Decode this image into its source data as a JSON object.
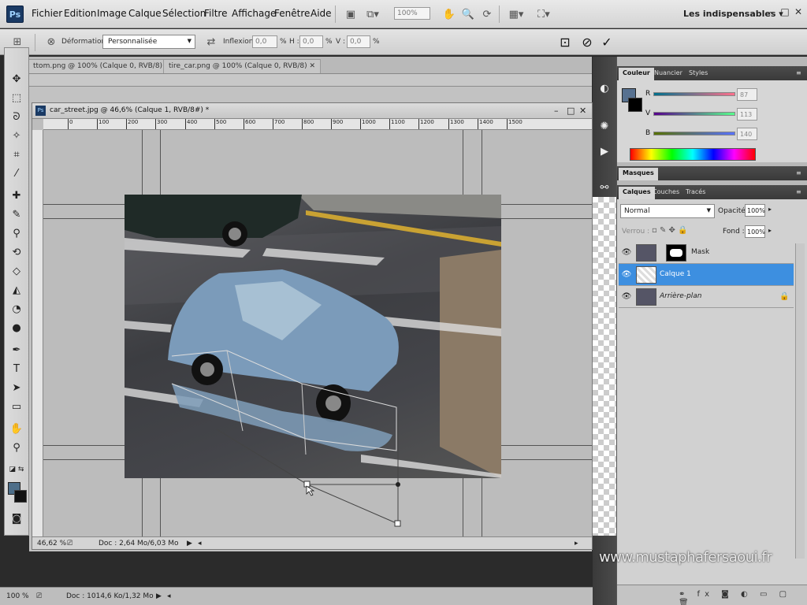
{
  "app": {
    "logo": "Ps"
  },
  "menu": [
    "Fichier",
    "Edition",
    "Image",
    "Calque",
    "Sélection",
    "Filtre",
    "Affichage",
    "Fenêtre",
    "Aide"
  ],
  "toolbar": {
    "zoom_value": "100%",
    "workspace": "Les indispensables ▾"
  },
  "options": {
    "deformation_label": "Déformation :",
    "deformation_value": "Personnalisée",
    "inflexion_label": "Inflexion :",
    "inflexion_value": "0,0",
    "h_label": "H :",
    "h_value": "0,0",
    "v_label": "V :",
    "v_value": "0,0",
    "pct": "%"
  },
  "doc_tabs": [
    "ttom.png @ 100% (Calque 0, RVB/8)",
    "tire_car.png @ 100% (Calque 0, RVB/8)"
  ],
  "document": {
    "title": "car_street.jpg @ 46,6% (Calque 1, RVB/8#) *",
    "ruler_ticks": [
      "0",
      "100",
      "200",
      "300",
      "400",
      "500",
      "600",
      "700",
      "800",
      "900",
      "1000",
      "1100",
      "1200",
      "1300",
      "1400",
      "1500"
    ],
    "zoom": "46,62 %",
    "doc_info": "Doc : 2,64 Mo/6,03 Mo"
  },
  "bottom_status": {
    "zoom": "100 %",
    "doc_info": "Doc : 1014,6 Ko/1,32 Mo"
  },
  "color_panel": {
    "tabs": [
      "Couleur",
      "Nuancier",
      "Styles"
    ],
    "r_label": "R",
    "r_value": "87",
    "v_label": "V",
    "v_value": "113",
    "b_label": "B",
    "b_value": "140",
    "fg_color": "#577190"
  },
  "masks_panel": {
    "title": "Masques"
  },
  "layers_panel": {
    "tabs": [
      "Calques",
      "Couches",
      "Tracés"
    ],
    "blend_mode": "Normal",
    "opacity_label": "Opacité :",
    "opacity_value": "100%",
    "lock_label": "Verrou :",
    "fill_label": "Fond :",
    "fill_value": "100%",
    "layers": [
      {
        "name": "Mask",
        "selected": false
      },
      {
        "name": "Calque 1",
        "selected": true
      },
      {
        "name": "Arrière-plan",
        "selected": false
      }
    ]
  },
  "watermark": "www.mustaphafersaoui.fr"
}
